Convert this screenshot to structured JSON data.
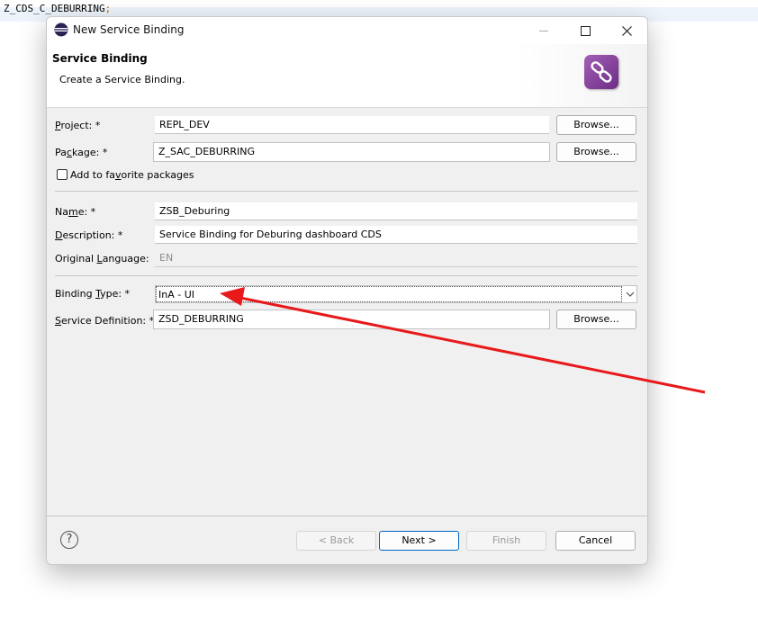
{
  "editor": {
    "text": "Z_CDS_C_DEBURRING",
    "semicolon": ";"
  },
  "window": {
    "title": "New Service Binding",
    "min_icon": "minimize-icon",
    "max_icon": "maximize-icon",
    "close_icon": "close-icon"
  },
  "banner": {
    "title": "Service Binding",
    "description": "Create a Service Binding.",
    "icon": "service-binding-link-icon"
  },
  "form": {
    "project": {
      "label_pre": "",
      "label_key": "P",
      "label_post": "roject: *",
      "value": "REPL_DEV",
      "browse": "Browse..."
    },
    "package": {
      "label_pre": "Pa",
      "label_key": "c",
      "label_post": "kage: *",
      "value": "Z_SAC_DEBURRING",
      "browse": "Browse..."
    },
    "favorite": {
      "label_pre": "Add to fa",
      "label_key": "v",
      "label_post": "orite packages",
      "checked": false
    },
    "name": {
      "label_pre": "Na",
      "label_key": "m",
      "label_post": "e: *",
      "value": "ZSB_Deburing"
    },
    "description": {
      "label_pre": "",
      "label_key": "D",
      "label_post": "escription: *",
      "value": "Service Binding for Deburing dashboard CDS"
    },
    "original_language": {
      "label_pre": "Original ",
      "label_key": "L",
      "label_post": "anguage:",
      "value": "EN"
    },
    "binding_type": {
      "label_pre": "Binding ",
      "label_key": "T",
      "label_post": "ype: *",
      "value": "InA - UI"
    },
    "service_definition": {
      "label_pre": "",
      "label_key": "S",
      "label_post": "ervice Definition: *",
      "value": "ZSD_DEBURRING",
      "browse": "Browse..."
    }
  },
  "footer": {
    "help_icon": "help-icon",
    "back": "< Back",
    "next": "Next >",
    "finish": "Finish",
    "cancel": "Cancel"
  },
  "annotation": {
    "color": "#e8191b"
  },
  "colors": {
    "accent": "#0067c0",
    "banner_icon": "#8a45a0"
  }
}
